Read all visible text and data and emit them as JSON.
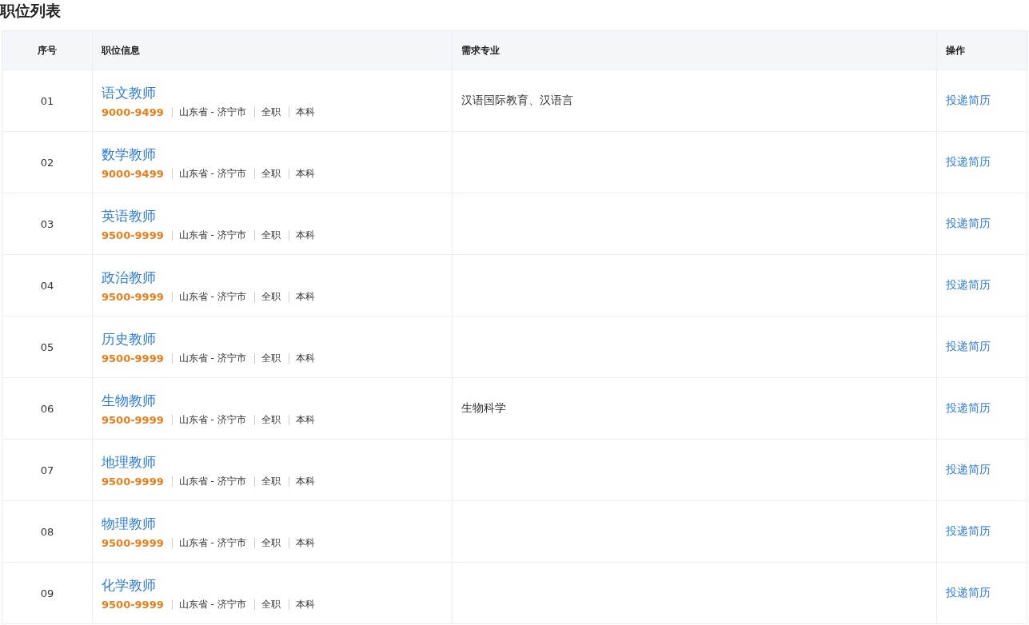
{
  "title": "职位列表",
  "table": {
    "columns": [
      "序号",
      "职位信息",
      "需求专业",
      "操作"
    ],
    "rows": [
      {
        "index": "01",
        "position": "语文教师",
        "salary": "9000-9499",
        "location": "山东省 - 济宁市",
        "type": "全职",
        "education": "本科",
        "major": "汉语国际教育、汉语言",
        "action": "投递简历"
      },
      {
        "index": "02",
        "position": "数学教师",
        "salary": "9000-9499",
        "location": "山东省 - 济宁市",
        "type": "全职",
        "education": "本科",
        "action": "投递简历"
      },
      {
        "index": "03",
        "position": "英语教师",
        "salary": "9500-9999",
        "location": "山东省 - 济宁市",
        "type": "全职",
        "education": "本科",
        "action": "投递简历"
      },
      {
        "index": "04",
        "position": "政治教师",
        "salary": "9500-9999",
        "location": "山东省 - 济宁市",
        "type": "全职",
        "education": "本科",
        "action": "投递简历"
      },
      {
        "index": "05",
        "position": "历史教师",
        "salary": "9500-9999",
        "location": "山东省 - 济宁市",
        "type": "全职",
        "education": "本科",
        "action": "投递简历"
      },
      {
        "index": "06",
        "position": "生物教师",
        "salary": "9500-9999",
        "location": "山东省 - 济宁市",
        "type": "全职",
        "education": "本科",
        "major": "生物科学",
        "action": "投递简历"
      },
      {
        "index": "07",
        "position": "地理教师",
        "salary": "9500-9999",
        "location": "山东省 - 济宁市",
        "type": "全职",
        "education": "本科",
        "action": "投递简历"
      },
      {
        "index": "08",
        "position": "物理教师",
        "salary": "9500-9999",
        "location": "山东省 - 济宁市",
        "type": "全职",
        "education": "本科",
        "action": "投递简历"
      },
      {
        "index": "09",
        "position": "化学教师",
        "salary": "9500-9999",
        "location": "山东省 - 济宁市",
        "type": "全职",
        "education": "本科",
        "action": "投递简历"
      }
    ]
  }
}
